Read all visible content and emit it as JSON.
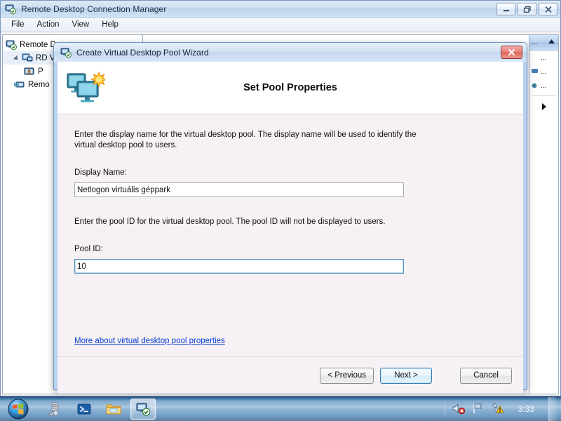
{
  "window": {
    "title": "Remote Desktop Connection Manager",
    "icon": "rdcm-icon",
    "buttons": {
      "minimize": "minimize-icon",
      "maximize": "restore-icon",
      "close": "close-icon"
    },
    "menu": [
      "File",
      "Action",
      "View",
      "Help"
    ]
  },
  "tree": {
    "items": [
      {
        "label": "Remote D",
        "icon": "rd-services-icon",
        "depth": 1,
        "selected": false
      },
      {
        "label": "RD Vi",
        "icon": "rd-virtualization-icon",
        "depth": 2,
        "selected": true
      },
      {
        "label": "P",
        "icon": "pool-icon",
        "depth": 3,
        "selected": false
      },
      {
        "label": "Remo",
        "icon": "remoteapp-icon",
        "depth": 2,
        "selected": false
      }
    ]
  },
  "actions_pane": {
    "header": "...",
    "collapse_icon": "collapse-up-icon",
    "items": [
      "...",
      "...",
      "..."
    ],
    "more_icon": "more-arrow-icon"
  },
  "dialog": {
    "title": "Create Virtual Desktop Pool Wizard",
    "title_icon": "wizard-icon",
    "close_label": "✕",
    "header": {
      "icon": "virtual-desktop-pool-icon",
      "heading": "Set Pool Properties"
    },
    "body": {
      "display_name_description": "Enter the display name for the virtual desktop pool.  The display name will be used to identify the virtual desktop pool to users.",
      "display_name_label": "Display Name:",
      "display_name_value": "Netlogon virtuális géppark",
      "display_name_placeholder": "",
      "pool_id_description": "Enter the pool ID for the virtual desktop pool.  The pool ID will not be displayed to users.",
      "pool_id_label": "Pool ID:",
      "pool_id_value": "10",
      "pool_id_placeholder": "",
      "more_link": "More about virtual desktop pool properties"
    },
    "footer": {
      "previous": "< Previous",
      "next": "Next >",
      "cancel": "Cancel"
    }
  },
  "taskbar": {
    "start_icon": "windows-start-orb",
    "items": [
      {
        "icon": "server-manager-icon",
        "active": false
      },
      {
        "icon": "powershell-icon",
        "active": false
      },
      {
        "icon": "file-explorer-icon",
        "active": false
      },
      {
        "icon": "rdcm-icon",
        "active": true
      }
    ],
    "tray": {
      "volume_icon": "volume-muted-icon",
      "network_icon": "network-flag-icon",
      "action_center_icon": "action-center-warning-icon",
      "clock": "3:33"
    }
  },
  "colors": {
    "accent": "#3c7fb1",
    "link": "#0b3fd4",
    "dialog_body": "#f6f1f4",
    "close_red": "#dc6459"
  }
}
